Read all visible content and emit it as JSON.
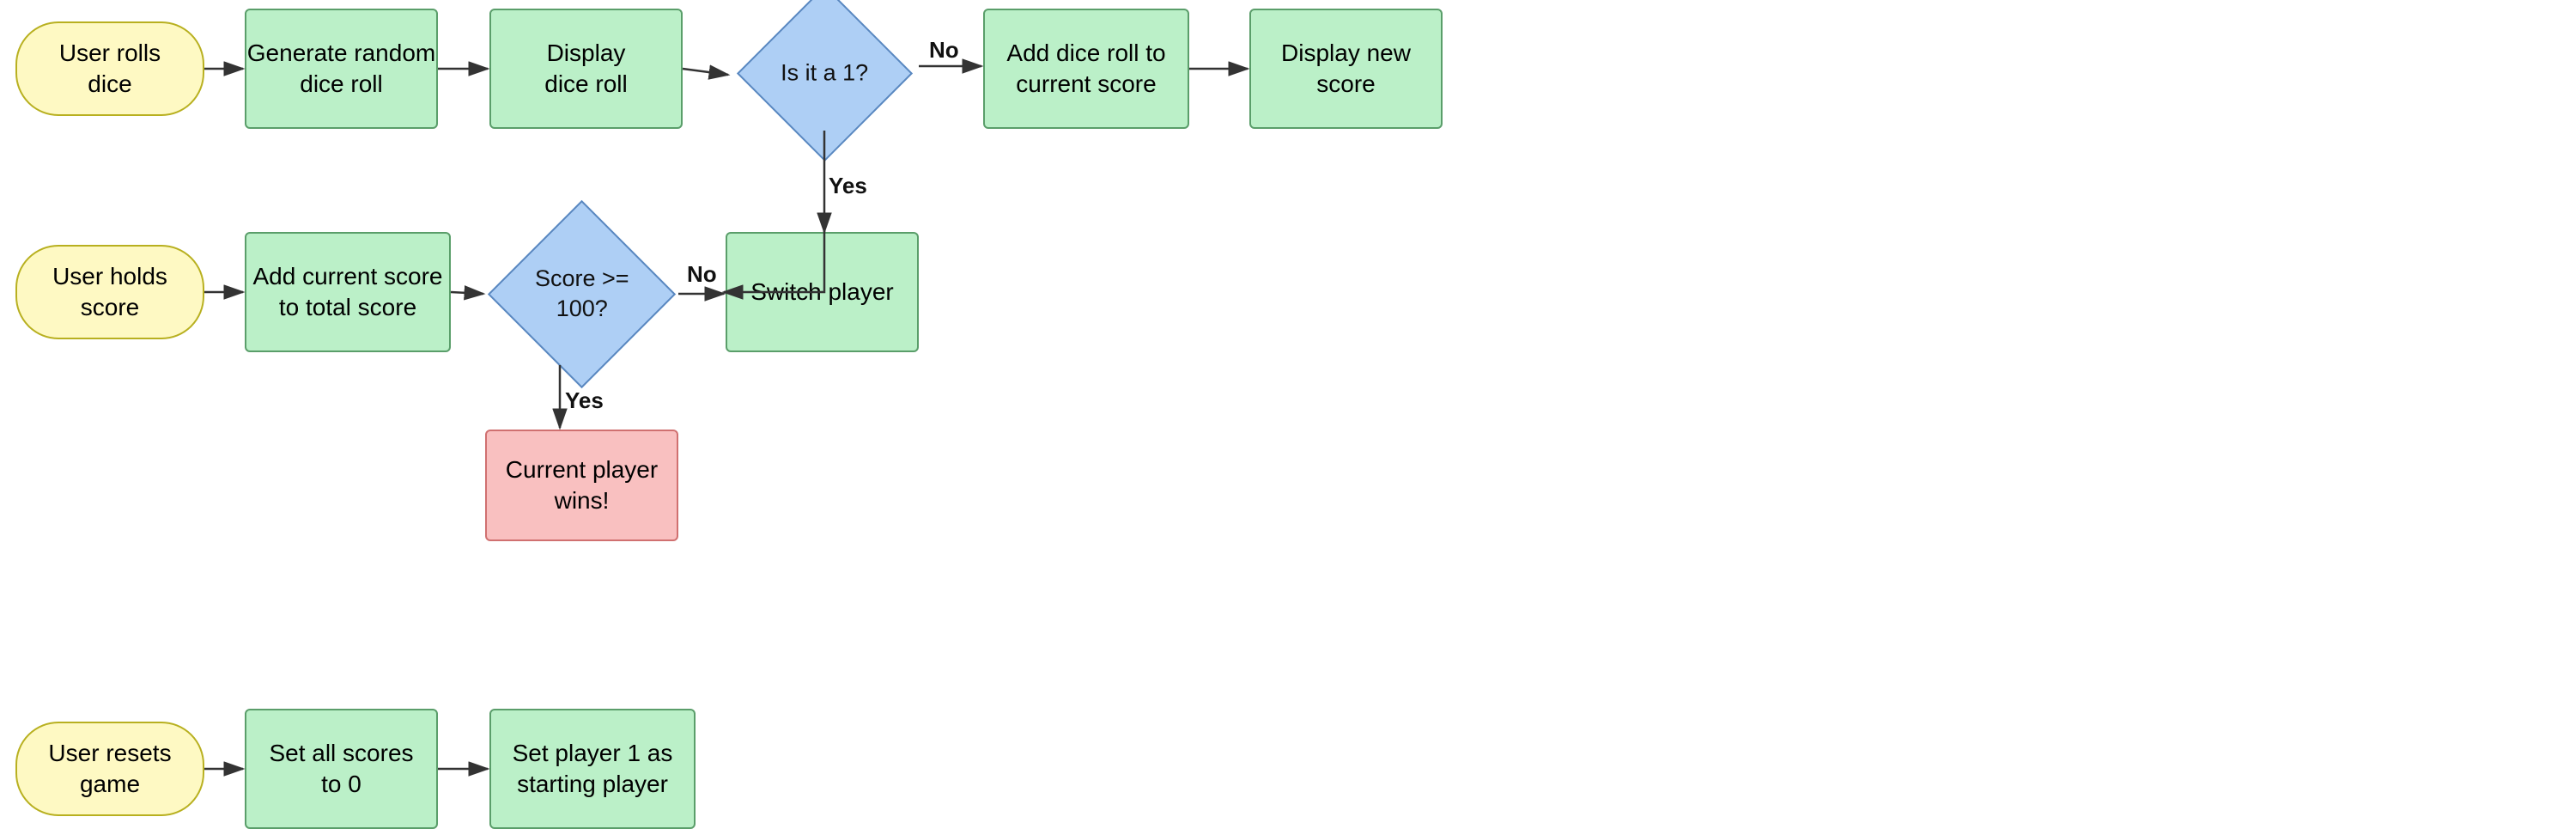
{
  "nodes": {
    "user_rolls_dice": {
      "label": "User rolls\ndice"
    },
    "generate_random": {
      "label": "Generate random\ndice roll"
    },
    "display_dice_roll": {
      "label": "Display\ndice roll"
    },
    "is_it_1": {
      "label": "Is it a 1?"
    },
    "add_dice_to_current": {
      "label": "Add dice roll to\ncurrent score"
    },
    "display_new_score": {
      "label": "Display new\nscore"
    },
    "user_holds_score": {
      "label": "User holds\nscore"
    },
    "add_current_to_total": {
      "label": "Add current score\nto total score"
    },
    "score_gte_100": {
      "label": "Score >= 100?"
    },
    "switch_player": {
      "label": "Switch player"
    },
    "current_player_wins": {
      "label": "Current player\nwins!"
    },
    "user_resets_game": {
      "label": "User resets\ngame"
    },
    "set_all_scores_0": {
      "label": "Set all scores\nto 0"
    },
    "set_player1_starting": {
      "label": "Set player 1 as\nstarting player"
    },
    "no_label_top": "No",
    "yes_label_top": "Yes",
    "no_label_mid": "No",
    "yes_label_mid": "Yes"
  }
}
